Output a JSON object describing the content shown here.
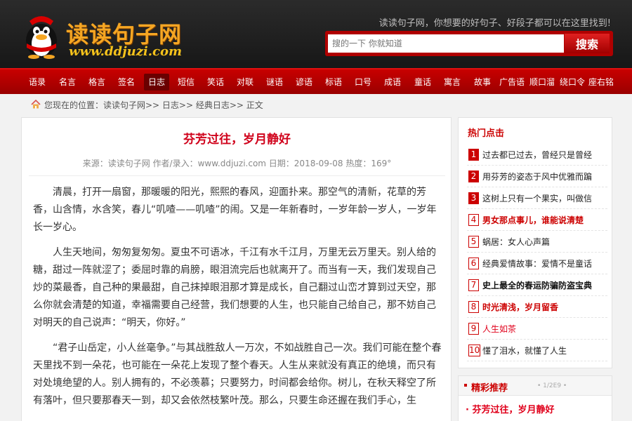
{
  "header": {
    "logo_cn": "读读句子网",
    "logo_en": "www.ddjuzi.com",
    "slogan": "读读句子网，你想要的好句子、好段子都可以在这里找到!",
    "search_placeholder": "搜的一下 你就知道",
    "search_button": "搜索"
  },
  "nav": {
    "active": "日志",
    "items": [
      "语录",
      "名言",
      "格言",
      "签名",
      "日志",
      "短信",
      "笑话",
      "对联",
      "谜语",
      "谚语",
      "标语",
      "口号",
      "成语",
      "童话",
      "寓言",
      "故事",
      "广告语",
      "顺口溜",
      "绕口令",
      "座右铭"
    ]
  },
  "breadcrumb": {
    "text": "您现在的位置：读读句子网>> 日志>> 经典日志>> 正文"
  },
  "article": {
    "title": "芬芳过往，岁月静好",
    "meta": "来源：读读句子网 作者/录入：www.ddjuzi.com 日期：2018-09-08 热度：169°",
    "paragraphs": [
      "清晨，打开一扇窗，那暖暖的阳光，熙熙的春风，迎面扑来。那空气的清新，花草的芳香，山含情，水含笑，春儿“叽喳——叽喳”的闹。又是一年新春时，一岁年龄一岁人，一岁年长一岁心。",
      "人生天地间，匆匆复匆匆。夏虫不可语冰，千江有水千江月，万里无云万里天。别人给的糖，甜过一阵就涩了；委屈时靠的肩膀，眼泪流完后也就离开了。而当有一天，我们发现自己炒的菜最香，自己种的果最甜，自己抹掉眼泪那才算是成长，自己翻过山峦才算到过天空，那么你就会清楚的知道，幸福需要自己经营，我们想要的人生，也只能自己给自己，那不妨自己对明天的自己说声：“明天，你好。”",
      "“君子山岳定，小人丝毫争。”与其战胜敌人一万次，不如战胜自己一次。我们可能在整个春天里找不到一朵花，也可能在一朵花上发现了整个春天。人生从来就没有真正的绝境，而只有对处境绝望的人。别人拥有的，不必羡慕；只要努力，时间都会给你。树儿，在秋天释空了所有落叶，但只要那春天一到，却又会依然枝繁叶茂。那么，只要生命还握在我们手心，生"
    ]
  },
  "hot": {
    "title": "热门点击",
    "items": [
      {
        "num": "1",
        "text": "过去都已过去，曾经只是曾经"
      },
      {
        "num": "2",
        "text": "用芬芳的姿态于风中优雅而蹁"
      },
      {
        "num": "3",
        "text": "这树上只有一个果实，叫做信"
      },
      {
        "num": "4",
        "text": "男女那点事儿，谁能说清楚"
      },
      {
        "num": "5",
        "text": "蜗居：女人心声篇"
      },
      {
        "num": "6",
        "text": "经典爱情故事：爱情不是童话"
      },
      {
        "num": "7",
        "text": "史上最全的春运防骗防盗宝典"
      },
      {
        "num": "8",
        "text": "时光清浅，岁月留香"
      },
      {
        "num": "9",
        "text": "人生如茶"
      },
      {
        "num": "10",
        "text": "懂了泪水，就懂了人生"
      }
    ]
  },
  "recommend": {
    "title": "精彩推荐",
    "sub": "• 1/2E9 •",
    "items": [
      "芬芳过往，岁月静好"
    ]
  },
  "colors": {
    "brand_red": "#c00000",
    "title_red": "#d0021b",
    "header_dark": "#1f1f1f"
  }
}
